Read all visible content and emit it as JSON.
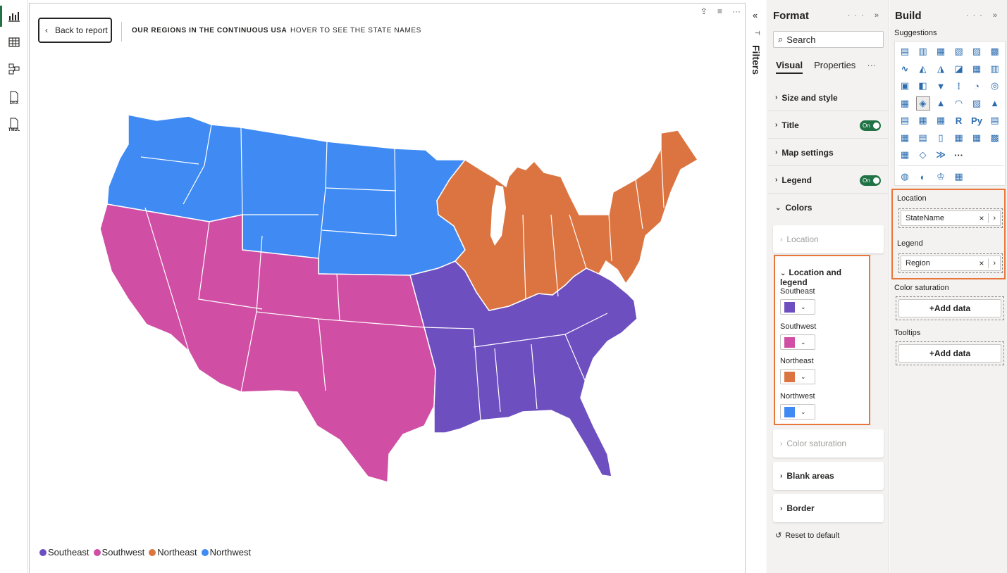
{
  "rail": {
    "items": [
      {
        "name": "report-view-icon"
      },
      {
        "name": "table-view-icon"
      },
      {
        "name": "model-view-icon"
      },
      {
        "name": "dax-query-icon",
        "text": "DAX"
      },
      {
        "name": "tmdl-view-icon",
        "text": "TMDL"
      }
    ]
  },
  "canvas": {
    "back_label": "Back to report",
    "header_title": "OUR REGIONS IN THE CONTINUOUS USA",
    "header_subtitle": "HOVER TO SEE THE STATE NAMES",
    "legend": [
      {
        "label": "Southeast",
        "color": "#6e4fc0"
      },
      {
        "label": "Southwest",
        "color": "#d04fa4"
      },
      {
        "label": "Northeast",
        "color": "#dc7441"
      },
      {
        "label": "Northwest",
        "color": "#3f8bf3"
      }
    ]
  },
  "filters": {
    "collapse": "«",
    "label": "Filters"
  },
  "format": {
    "title": "Format",
    "controls": "··· »",
    "search_label": "Search",
    "tabs": {
      "visual": "Visual",
      "properties": "Properties",
      "more": "···"
    },
    "sections": [
      {
        "label": "Size and style"
      },
      {
        "label": "Title",
        "toggle": "On"
      },
      {
        "label": "Map settings"
      },
      {
        "label": "Legend",
        "toggle": "On"
      },
      {
        "label": "Colors"
      }
    ],
    "cards": {
      "location": "Location",
      "location_and_legend": "Location and legend",
      "color_saturation": "Color saturation",
      "blank_areas": "Blank areas",
      "border": "Border"
    },
    "swatches": [
      {
        "label": "Southeast",
        "color": "#6e4fc0"
      },
      {
        "label": "Southwest",
        "color": "#d04fa4"
      },
      {
        "label": "Northeast",
        "color": "#dc7441"
      },
      {
        "label": "Northwest",
        "color": "#3f8bf3"
      }
    ],
    "reset": "Reset to default"
  },
  "build": {
    "title": "Build",
    "controls": "··· »",
    "suggestions": "Suggestions",
    "more_visuals": "···",
    "wells": {
      "location_label": "Location",
      "location_value": "StateName",
      "legend_label": "Legend",
      "legend_value": "Region",
      "saturation_label": "Color saturation",
      "tooltips_label": "Tooltips",
      "add_data": "+Add data"
    }
  }
}
